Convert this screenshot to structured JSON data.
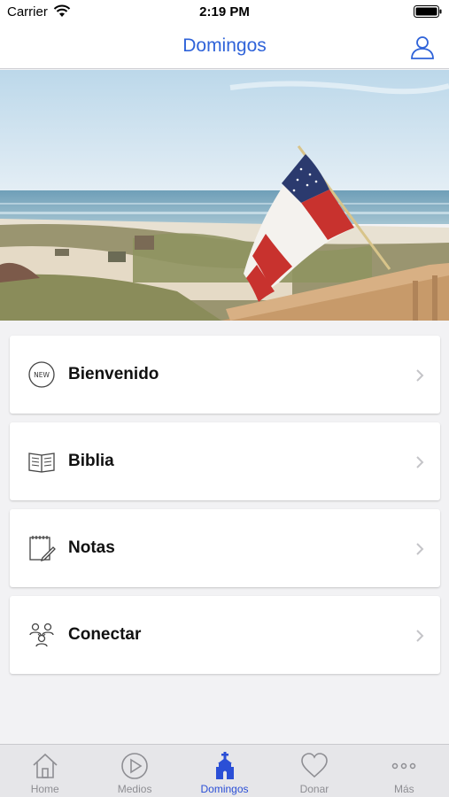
{
  "status_bar": {
    "carrier": "Carrier",
    "time": "2:19 PM"
  },
  "nav": {
    "title": "Domingos"
  },
  "cards": [
    {
      "label": "Bienvenido",
      "icon": "new-badge-icon",
      "badge_text": "NEW"
    },
    {
      "label": "Biblia",
      "icon": "open-book-icon"
    },
    {
      "label": "Notas",
      "icon": "notepad-pencil-icon"
    },
    {
      "label": "Conectar",
      "icon": "people-group-icon"
    }
  ],
  "tabs": [
    {
      "label": "Home",
      "icon": "house-icon",
      "active": false
    },
    {
      "label": "Medios",
      "icon": "play-circle-icon",
      "active": false
    },
    {
      "label": "Domingos",
      "icon": "church-icon",
      "active": true
    },
    {
      "label": "Donar",
      "icon": "heart-icon",
      "active": false
    },
    {
      "label": "Más",
      "icon": "more-dots-icon",
      "active": false
    }
  ],
  "colors": {
    "accent": "#2f63d9",
    "tab_active": "#2b4fd6",
    "tab_inactive": "#8e8e93",
    "background": "#f2f2f4"
  }
}
